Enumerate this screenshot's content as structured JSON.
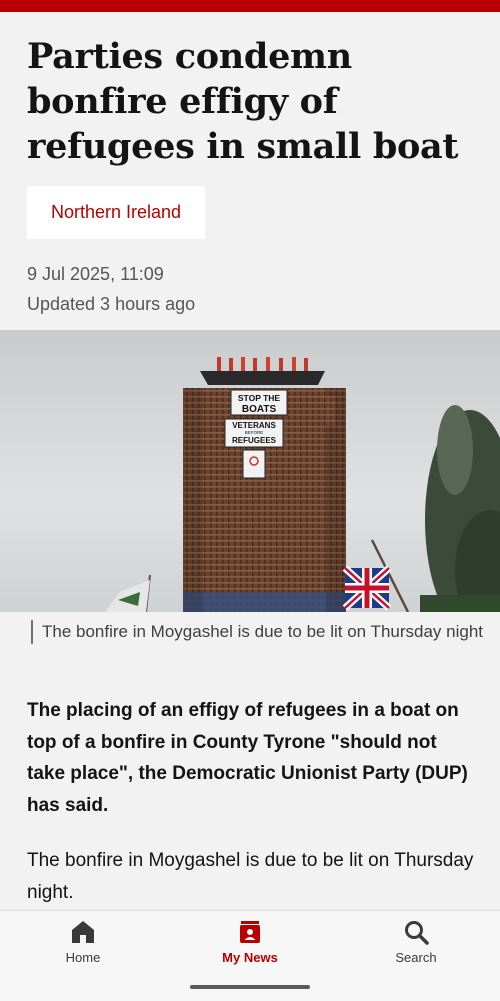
{
  "article": {
    "headline": "Parties condemn bonfire effigy of refugees in small boat",
    "topic_tag": "Northern Ireland",
    "date": "9 Jul 2025, 11:09",
    "updated": "Updated 3 hours ago",
    "image": {
      "sign_1": "STOP THE BOATS",
      "sign_2": "VETERANS BEFORE REFUGEES"
    },
    "caption": "The bonfire in Moygashel is due to be lit on Thursday night",
    "lead": "The placing of an effigy of refugees in a boat on top of a bonfire in County Tyrone \"should not take place\", the Democratic Unionist Party (DUP) has said.",
    "paragraph_1": "The bonfire in Moygashel is due to be lit on Thursday night."
  },
  "nav": {
    "home_label": "Home",
    "mynews_label": "My News",
    "search_label": "Search",
    "active": "My News"
  },
  "colors": {
    "brand_red": "#b80000",
    "background": "#f2f2f2"
  },
  "icons": {
    "home": "home-icon",
    "mynews": "my-news-icon",
    "search": "search-icon"
  }
}
